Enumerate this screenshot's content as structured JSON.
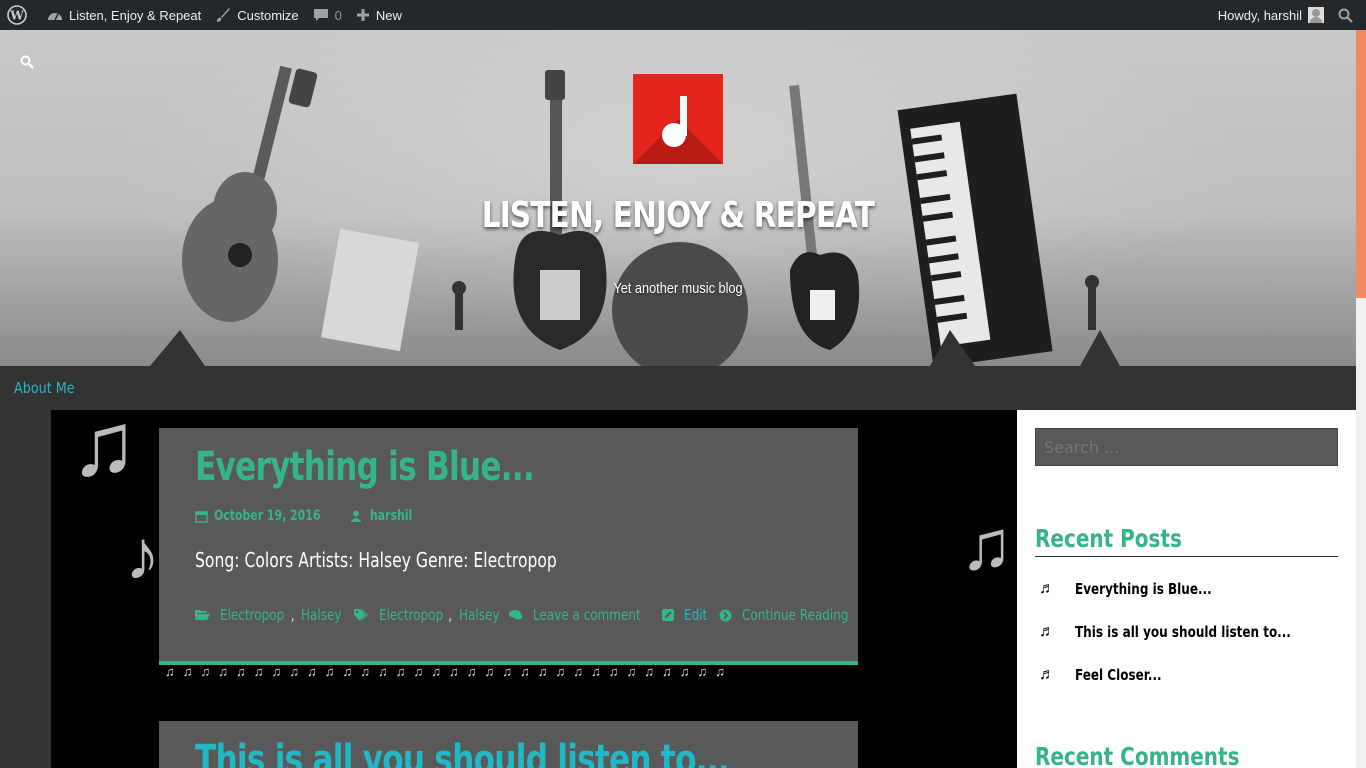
{
  "adminbar": {
    "site_name": "Listen, Enjoy & Repeat",
    "customize": "Customize",
    "comments_count": "0",
    "new_label": "New",
    "howdy": "Howdy, harshil"
  },
  "header": {
    "site_title": "LISTEN, ENJOY & REPEAT",
    "tagline": "Yet another music blog"
  },
  "nav": {
    "items": [
      {
        "label": "About Me"
      }
    ]
  },
  "posts": [
    {
      "title": "Everything is Blue...",
      "date": "October 19, 2016",
      "author": "harshil",
      "excerpt": "Song: Colors Artists: Halsey Genre: Electropop",
      "categories": [
        "Electropop",
        "Halsey"
      ],
      "tags": [
        "Electropop",
        "Halsey"
      ],
      "comment_link": "Leave a comment",
      "edit_link": "Edit",
      "continue_link": "Continue Reading"
    },
    {
      "title": "This is all you should listen to..."
    }
  ],
  "sidebar": {
    "search_placeholder": "Search ...",
    "recent_posts_title": "Recent Posts",
    "recent_posts": [
      {
        "label": "Everything is Blue..."
      },
      {
        "label": "This is all you should listen to..."
      },
      {
        "label": "Feel Closer..."
      }
    ],
    "recent_comments_title": "Recent Comments"
  },
  "colors": {
    "accent_green": "#35b389",
    "accent_cyan": "#21b8c5",
    "logo_red": "#e3251e",
    "adminbar": "#23282d"
  }
}
